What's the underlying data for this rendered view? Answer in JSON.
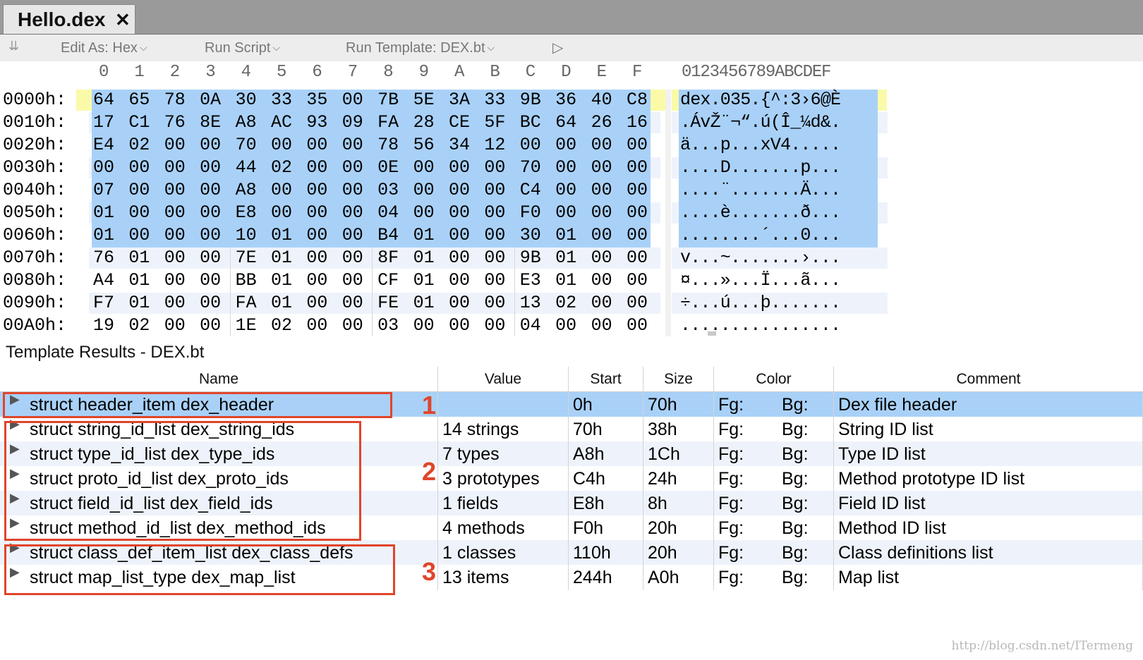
{
  "tab": {
    "title": "Hello.dex",
    "close": "✕"
  },
  "toolbar": {
    "edit_as": "Edit As: Hex",
    "run_script": "Run Script",
    "run_template": "Run Template: DEX.bt"
  },
  "hex": {
    "columns": [
      "0",
      "1",
      "2",
      "3",
      "4",
      "5",
      "6",
      "7",
      "8",
      "9",
      "A",
      "B",
      "C",
      "D",
      "E",
      "F"
    ],
    "ascii_header": "0123456789ABCDEF",
    "rows": [
      {
        "offset": "0000h:",
        "bytes": [
          "64",
          "65",
          "78",
          "0A",
          "30",
          "33",
          "35",
          "00",
          "7B",
          "5E",
          "3A",
          "33",
          "9B",
          "36",
          "40",
          "C8"
        ],
        "ascii": "dex.035.{^:3›6@È"
      },
      {
        "offset": "0010h:",
        "bytes": [
          "17",
          "C1",
          "76",
          "8E",
          "A8",
          "AC",
          "93",
          "09",
          "FA",
          "28",
          "CE",
          "5F",
          "BC",
          "64",
          "26",
          "16"
        ],
        "ascii": ".ÁvŽ¨¬“.ú(Î_¼d&."
      },
      {
        "offset": "0020h:",
        "bytes": [
          "E4",
          "02",
          "00",
          "00",
          "70",
          "00",
          "00",
          "00",
          "78",
          "56",
          "34",
          "12",
          "00",
          "00",
          "00",
          "00"
        ],
        "ascii": "ä...p...xV4....."
      },
      {
        "offset": "0030h:",
        "bytes": [
          "00",
          "00",
          "00",
          "00",
          "44",
          "02",
          "00",
          "00",
          "0E",
          "00",
          "00",
          "00",
          "70",
          "00",
          "00",
          "00"
        ],
        "ascii": "....D.......p..."
      },
      {
        "offset": "0040h:",
        "bytes": [
          "07",
          "00",
          "00",
          "00",
          "A8",
          "00",
          "00",
          "00",
          "03",
          "00",
          "00",
          "00",
          "C4",
          "00",
          "00",
          "00"
        ],
        "ascii": "....¨.......Ä..."
      },
      {
        "offset": "0050h:",
        "bytes": [
          "01",
          "00",
          "00",
          "00",
          "E8",
          "00",
          "00",
          "00",
          "04",
          "00",
          "00",
          "00",
          "F0",
          "00",
          "00",
          "00"
        ],
        "ascii": "....è.......ð..."
      },
      {
        "offset": "0060h:",
        "bytes": [
          "01",
          "00",
          "00",
          "00",
          "10",
          "01",
          "00",
          "00",
          "B4",
          "01",
          "00",
          "00",
          "30",
          "01",
          "00",
          "00"
        ],
        "ascii": "........´...0..."
      },
      {
        "offset": "0070h:",
        "bytes": [
          "76",
          "01",
          "00",
          "00",
          "7E",
          "01",
          "00",
          "00",
          "8F",
          "01",
          "00",
          "00",
          "9B",
          "01",
          "00",
          "00"
        ],
        "ascii": "v...~.......›..."
      },
      {
        "offset": "0080h:",
        "bytes": [
          "A4",
          "01",
          "00",
          "00",
          "BB",
          "01",
          "00",
          "00",
          "CF",
          "01",
          "00",
          "00",
          "E3",
          "01",
          "00",
          "00"
        ],
        "ascii": "¤...»...Ï...ã..."
      },
      {
        "offset": "0090h:",
        "bytes": [
          "F7",
          "01",
          "00",
          "00",
          "FA",
          "01",
          "00",
          "00",
          "FE",
          "01",
          "00",
          "00",
          "13",
          "02",
          "00",
          "00"
        ],
        "ascii": "÷...ú...þ......."
      },
      {
        "offset": "00A0h:",
        "bytes": [
          "19",
          "02",
          "00",
          "00",
          "1E",
          "02",
          "00",
          "00",
          "03",
          "00",
          "00",
          "00",
          "04",
          "00",
          "00",
          "00"
        ],
        "ascii": "................"
      }
    ]
  },
  "template_results": {
    "title": "Template Results - DEX.bt",
    "headers": {
      "name": "Name",
      "value": "Value",
      "start": "Start",
      "size": "Size",
      "color": "Color",
      "comment": "Comment"
    },
    "rows": [
      {
        "name": "struct header_item dex_header",
        "value": "",
        "start": "0h",
        "size": "70h",
        "fg": "Fg:",
        "bg": "Bg:",
        "comment": "Dex file header"
      },
      {
        "name": "struct string_id_list dex_string_ids",
        "value": "14 strings",
        "start": "70h",
        "size": "38h",
        "fg": "Fg:",
        "bg": "Bg:",
        "comment": "String ID list"
      },
      {
        "name": "struct type_id_list dex_type_ids",
        "value": "7 types",
        "start": "A8h",
        "size": "1Ch",
        "fg": "Fg:",
        "bg": "Bg:",
        "comment": "Type ID list"
      },
      {
        "name": "struct proto_id_list dex_proto_ids",
        "value": "3 prototypes",
        "start": "C4h",
        "size": "24h",
        "fg": "Fg:",
        "bg": "Bg:",
        "comment": "Method prototype ID list"
      },
      {
        "name": "struct field_id_list dex_field_ids",
        "value": "1 fields",
        "start": "E8h",
        "size": "8h",
        "fg": "Fg:",
        "bg": "Bg:",
        "comment": "Field ID list"
      },
      {
        "name": "struct method_id_list dex_method_ids",
        "value": "4 methods",
        "start": "F0h",
        "size": "20h",
        "fg": "Fg:",
        "bg": "Bg:",
        "comment": "Method ID list"
      },
      {
        "name": "struct class_def_item_list dex_class_defs",
        "value": "1 classes",
        "start": "110h",
        "size": "20h",
        "fg": "Fg:",
        "bg": "Bg:",
        "comment": "Class definitions list"
      },
      {
        "name": "struct map_list_type dex_map_list",
        "value": "13 items",
        "start": "244h",
        "size": "A0h",
        "fg": "Fg:",
        "bg": "Bg:",
        "comment": "Map list"
      }
    ]
  },
  "annotations": {
    "label1": "1",
    "label2": "2",
    "label3": "3"
  },
  "colors": {
    "selection": "#a9d1f8",
    "annotation": "#e0452b",
    "highlight": "#fafaa8"
  },
  "watermark": "http://blog.csdn.net/ITermeng"
}
